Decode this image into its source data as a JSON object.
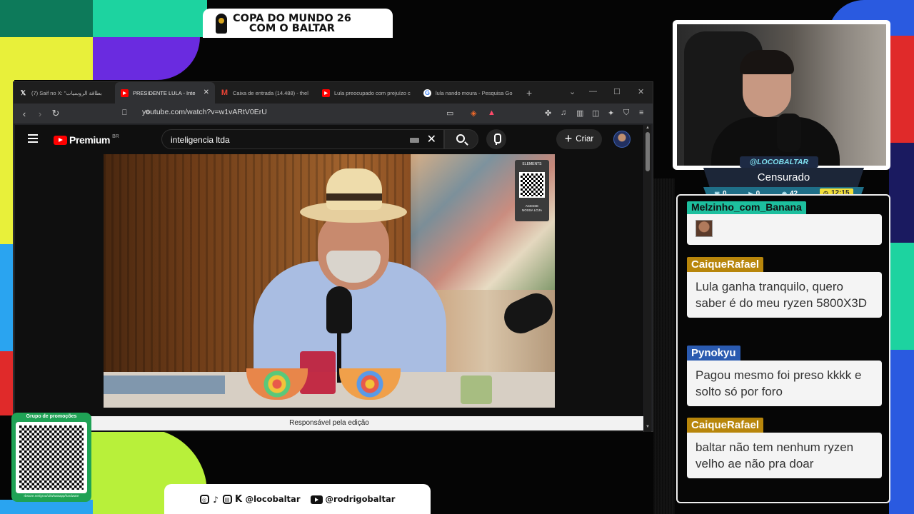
{
  "banner": {
    "line1": "COPA DO MUNDO 26",
    "line2": "COM O BALTAR"
  },
  "browser": {
    "tabs": [
      {
        "icon": "x-logo-icon",
        "label": "(7) Saif no X: \"بطاقة الروسيات",
        "active": false
      },
      {
        "icon": "youtube-icon",
        "label": "PRESIDENTE LULA - Inte",
        "active": true
      },
      {
        "icon": "gmail-icon",
        "label": "Caixa de entrada (14.488) - thel",
        "active": false
      },
      {
        "icon": "youtube-icon",
        "label": "Lula preocupado com prejuízo c",
        "active": false
      },
      {
        "icon": "google-icon",
        "label": "lula nando moura - Pesquisa Go",
        "active": false
      }
    ],
    "url": "youtube.com/watch?v=w1vARtV0ErU"
  },
  "youtube": {
    "logo_text": "Premium",
    "logo_region": "BR",
    "search_value": "inteligencia ltda",
    "create_label": "Criar",
    "caption": "Responsável pela edição",
    "qr_brand": "ELEMENTS",
    "qr_sub_1": "ACESSE",
    "qr_sub_2": "NOSSA LOJA"
  },
  "overlay": {
    "handle": "@LOCOBALTAR",
    "status": "Censurado",
    "stats": {
      "twitch": "0",
      "youtube": "0",
      "kick": "42",
      "timer": "12:15"
    }
  },
  "chat": {
    "messages": [
      {
        "user": "Melzinho_com_Banana",
        "color": "#1dbf9e",
        "text": ""
      },
      {
        "user": "CaiqueRafael",
        "color": "#b8860b",
        "text": "Lula ganha tranquilo, quero saber é do meu ryzen 5800X3D"
      },
      {
        "user": "Pynokyu",
        "color": "#2a5ab0",
        "text": "Pagou mesmo foi preso kkkk e solto só por foro"
      },
      {
        "user": "CaiqueRafael",
        "color": "#b8860b",
        "text": "baltar não tem nenhum ryzen velho ae não pra doar"
      }
    ]
  },
  "promo": {
    "title": "Grupo de promoções",
    "url": "rbstore.net/grou/ui/whatsapp/hardware"
  },
  "socials": {
    "handle1": "@locobaltar",
    "handle2": "@rodrigobaltar"
  }
}
